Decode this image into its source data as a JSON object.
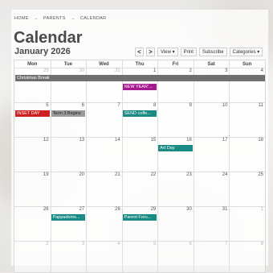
{
  "breadcrumb": {
    "items": [
      "HOME",
      "PARENTS",
      "CALENDAR"
    ],
    "sep": "→"
  },
  "page": {
    "title": "Calendar",
    "month": "January 2026"
  },
  "toolbar": {
    "prev": "<",
    "next": ">",
    "view": "View ▾",
    "print": "Print",
    "subscribe": "Subscribe",
    "categories": "Categories ▾"
  },
  "weekdays": [
    "Mon",
    "Tue",
    "Wed",
    "Thu",
    "Fri",
    "Sat",
    "Sun"
  ],
  "weeks": [
    [
      {
        "d": "29",
        "m": true
      },
      {
        "d": "30",
        "m": true
      },
      {
        "d": "31",
        "m": true
      },
      {
        "d": "1"
      },
      {
        "d": "2"
      },
      {
        "d": "3"
      },
      {
        "d": "4"
      }
    ],
    [
      {
        "d": "5"
      },
      {
        "d": "6"
      },
      {
        "d": "7"
      },
      {
        "d": "8"
      },
      {
        "d": "9"
      },
      {
        "d": "10"
      },
      {
        "d": "11"
      }
    ],
    [
      {
        "d": "12"
      },
      {
        "d": "13"
      },
      {
        "d": "14"
      },
      {
        "d": "15"
      },
      {
        "d": "16"
      },
      {
        "d": "17"
      },
      {
        "d": "18"
      }
    ],
    [
      {
        "d": "19"
      },
      {
        "d": "20"
      },
      {
        "d": "21"
      },
      {
        "d": "22"
      },
      {
        "d": "23"
      },
      {
        "d": "24"
      },
      {
        "d": "25"
      }
    ],
    [
      {
        "d": "26"
      },
      {
        "d": "27"
      },
      {
        "d": "28"
      },
      {
        "d": "29"
      },
      {
        "d": "30"
      },
      {
        "d": "31"
      },
      {
        "d": "1",
        "m": true
      }
    ],
    [
      {
        "d": "2",
        "m": true
      },
      {
        "d": "3",
        "m": true
      },
      {
        "d": "4",
        "m": true
      },
      {
        "d": "5",
        "m": true
      },
      {
        "d": "6",
        "m": true
      },
      {
        "d": "7",
        "m": true
      },
      {
        "d": "8",
        "m": true
      }
    ]
  ],
  "events": [
    {
      "label": "Christmas Break",
      "week": 0,
      "col": 0,
      "span": 7,
      "row": 0,
      "color": "#6f6f6f"
    },
    {
      "label": "NEW YEAR'...",
      "week": 0,
      "col": 3,
      "span": 1,
      "row": 1,
      "color": "#a51a8f"
    },
    {
      "label": "INSET DAY",
      "week": 1,
      "col": 0,
      "span": 1,
      "row": 0,
      "color": "#cc1f1f"
    },
    {
      "label": "Term 3 Begins",
      "week": 1,
      "col": 1,
      "span": 1,
      "row": 0,
      "color": "#9a9a9a",
      "text": "#222"
    },
    {
      "label": "SEND coffe...",
      "week": 1,
      "col": 3,
      "span": 1,
      "row": 0,
      "color": "#1a8a84"
    },
    {
      "label": "Art Day",
      "week": 2,
      "col": 4,
      "span": 1,
      "row": 0,
      "color": "#1a8a84"
    },
    {
      "label": "Pappadoms...",
      "week": 4,
      "col": 1,
      "span": 1,
      "row": 0,
      "color": "#1a8a84"
    },
    {
      "label": "Parent Foru...",
      "week": 4,
      "col": 3,
      "span": 1,
      "row": 0,
      "color": "#1a8a84"
    }
  ]
}
